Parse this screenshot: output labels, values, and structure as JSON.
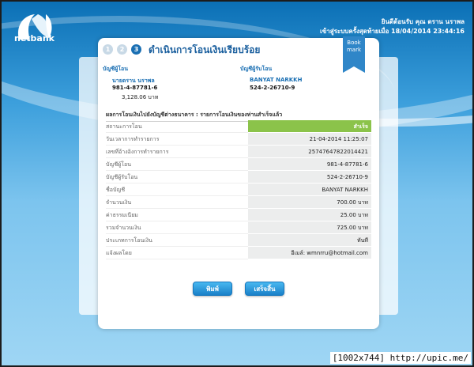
{
  "brand": {
    "logo_text": "netbank"
  },
  "header": {
    "welcome": "ยินดีต้อนรับ คุณ ดราน นราพล",
    "last_login": "เข้าสู่ระบบครั้งสุดท้ายเมื่อ 18/04/2014 23:44:16"
  },
  "steps": [
    "1",
    "2",
    "3"
  ],
  "page_title": "ดำเนินการโอนเงินเรียบร้อย",
  "bookmark": {
    "line1": "Book",
    "line2": "mark"
  },
  "from_account": {
    "heading": "บัญชีผู้โอน",
    "name": "นายดราน นราพล",
    "number": "981-4-87781-6",
    "balance": "3,128.06 บาท"
  },
  "to_account": {
    "heading": "บัญชีผู้รับโอน",
    "name": "BANYAT NARKKH",
    "number": "524-2-26710-9"
  },
  "result_title": "ผลการโอนเงินไปยังบัญชีต่างธนาคาร : รายการโอนเงินของท่านสำเร็จแล้ว",
  "rows": [
    {
      "label": "สถานะการโอน",
      "value": "สำเร็จ",
      "status": true
    },
    {
      "label": "วันเวลาการทำรายการ",
      "value": "21-04-2014 11:25:07"
    },
    {
      "label": "เลขที่อ้างอิงการทำรายการ",
      "value": "25747647822014421"
    },
    {
      "label": "บัญชีผู้โอน",
      "value": "981-4-87781-6"
    },
    {
      "label": "บัญชีผู้รับโอน",
      "value": "524-2-26710-9"
    },
    {
      "label": "ชื่อบัญชี",
      "value": "BANYAT NARKKH"
    },
    {
      "label": "จำนวนเงิน",
      "value": "700.00 บาท"
    },
    {
      "label": "ค่าธรรมเนียม",
      "value": "25.00 บาท"
    },
    {
      "label": "รวมจำนวนเงิน",
      "value": "725.00 บาท"
    },
    {
      "label": "ประเภทการโอนเงิน",
      "value": "ทันที"
    },
    {
      "label": "แจ้งผลโดย",
      "value": "อีเมล์: wmnrru@hotmail.com"
    }
  ],
  "buttons": {
    "print": "พิมพ์",
    "finish": "เสร็จสิ้น"
  },
  "watermark": "[1002x744] http://upic.me/",
  "colors": {
    "accent": "#1a6fb3",
    "success": "#8bc34a",
    "button": "#2a95dc"
  }
}
